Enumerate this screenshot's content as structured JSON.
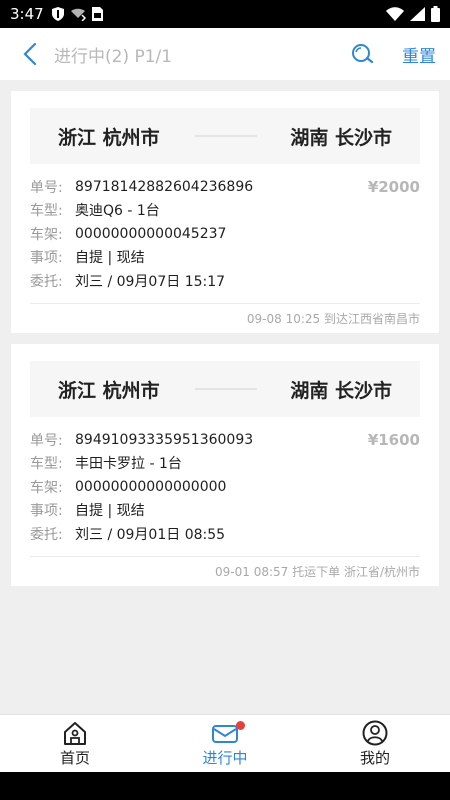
{
  "status_bar": {
    "time": "3:47",
    "icons": [
      "shield-icon",
      "cast-icon",
      "sim-icon",
      "wifi-icon",
      "signal-icon",
      "battery-icon"
    ]
  },
  "header": {
    "title": "进行中(2) P1/1",
    "reset_label": "重置",
    "accent": "#2f86d8"
  },
  "orders": [
    {
      "from": "浙江 杭州市",
      "to": "湖南 长沙市",
      "price": "¥2000",
      "fields": [
        {
          "label": "单号:",
          "value": "8971814288260423689​6"
        },
        {
          "label": "车型:",
          "value": "奥迪Q6 - 1台"
        },
        {
          "label": "车架:",
          "value": "00000000000045237"
        },
        {
          "label": "事项:",
          "value": "自提 | 现结"
        },
        {
          "label": "委托:",
          "value": "刘三 / 09月07日 15:17"
        }
      ],
      "note": "09-08 10:25 到达江西省南昌市"
    },
    {
      "from": "浙江 杭州市",
      "to": "湖南 长沙市",
      "price": "¥1600",
      "fields": [
        {
          "label": "单号:",
          "value": "89491093335951360093"
        },
        {
          "label": "车型:",
          "value": "丰田卡罗拉 - 1台"
        },
        {
          "label": "车架:",
          "value": "00000000000000000"
        },
        {
          "label": "事项:",
          "value": "自提 | 现结"
        },
        {
          "label": "委托:",
          "value": "刘三 / 09月01日 08:55"
        }
      ],
      "note": "09-01 08:57 托运下单 浙江省/杭州市"
    }
  ],
  "tabs": [
    {
      "label": "首页",
      "icon": "home-icon"
    },
    {
      "label": "进行中",
      "icon": "mail-icon"
    },
    {
      "label": "我的",
      "icon": "user-icon"
    }
  ]
}
